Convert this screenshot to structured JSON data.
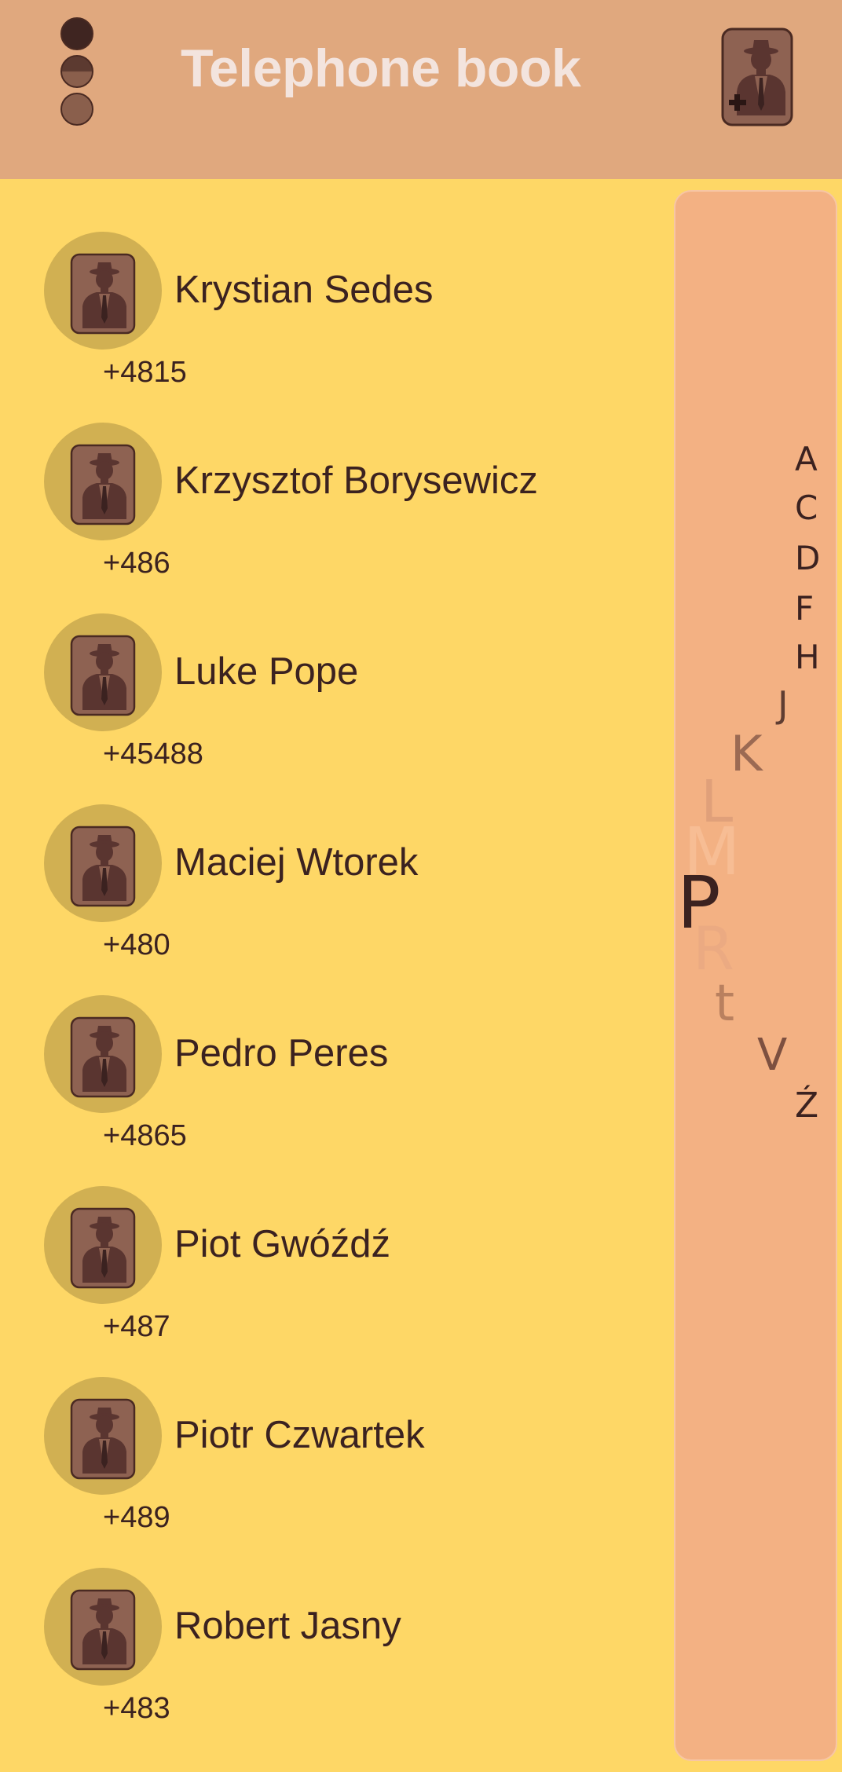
{
  "app": {
    "title": "Telephone book"
  },
  "icons": {
    "menu": "three-dot-menu-icon",
    "add_contact": "add-contact-icon",
    "contact_avatar": "person-with-hat-icon"
  },
  "colors": {
    "background": "#fed766",
    "appbar": "#e0a87e",
    "title_text": "#f3e4de",
    "avatar_circle": "#d1b052",
    "index_panel": "#f3b183",
    "text": "#3b2220"
  },
  "contacts": [
    {
      "name": "Krystian Sedes",
      "phone": "+4815"
    },
    {
      "name": "Krzysztof Borysewicz",
      "phone": "+486"
    },
    {
      "name": "Luke Pope",
      "phone": "+45488"
    },
    {
      "name": "Maciej Wtorek",
      "phone": "+480"
    },
    {
      "name": "Pedro Peres",
      "phone": "+4865"
    },
    {
      "name": "Piot Gwóźdź",
      "phone": "+487"
    },
    {
      "name": "Piotr Czwartek",
      "phone": "+489"
    },
    {
      "name": "Robert Jasny",
      "phone": "+483"
    }
  ],
  "alphabet_index": {
    "letters": [
      "A",
      "C",
      "D",
      "F",
      "H",
      "J",
      "K",
      "L",
      "M",
      "P",
      "R",
      "t",
      "V",
      "Ź"
    ],
    "selected": "P"
  }
}
